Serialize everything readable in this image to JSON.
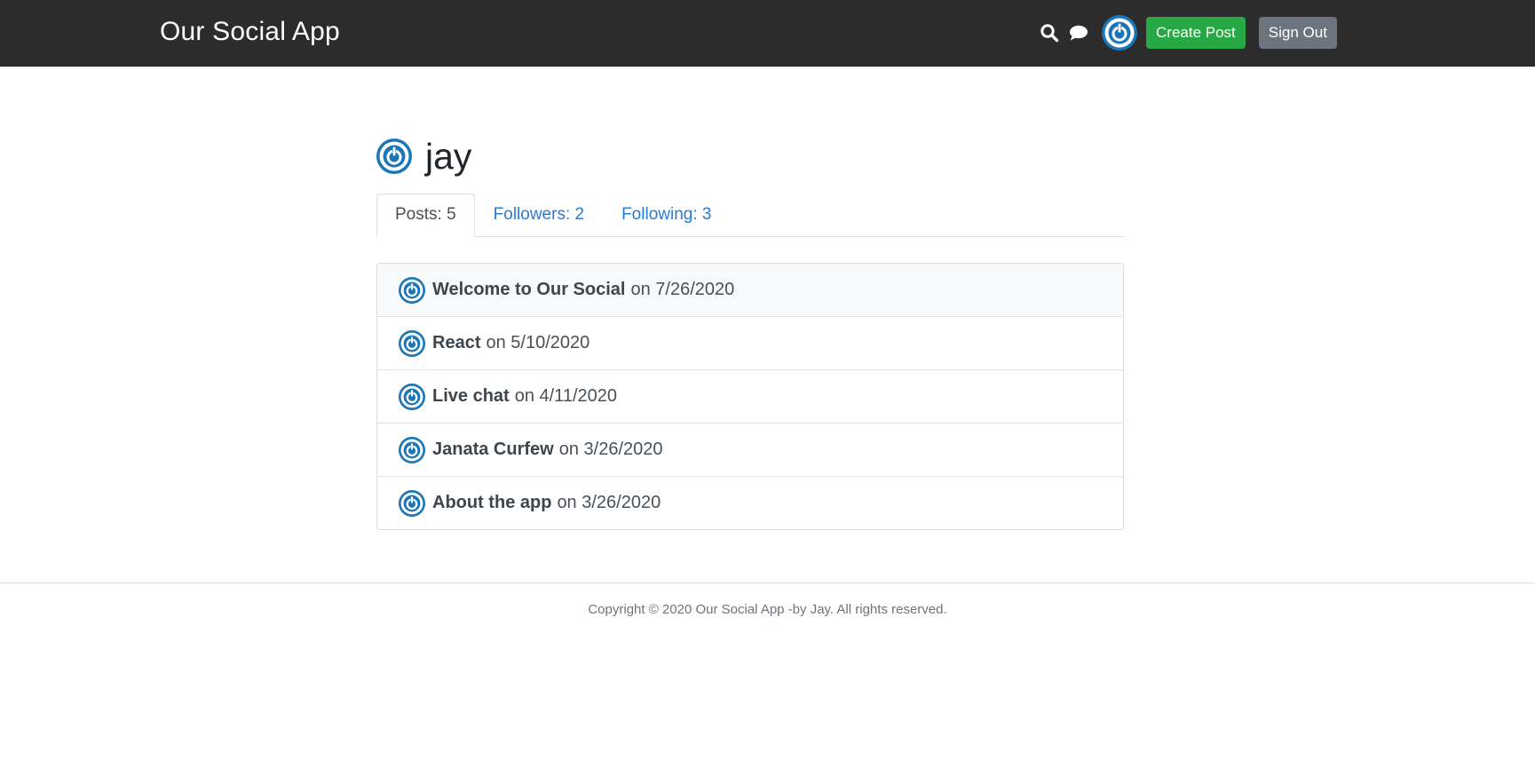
{
  "header": {
    "brand": "Our Social App",
    "icons": {
      "search": "search-icon",
      "chat": "chat-icon",
      "avatar": "avatar"
    },
    "create_post_label": "Create Post",
    "sign_out_label": "Sign Out"
  },
  "profile": {
    "username": "jay"
  },
  "tabs": [
    {
      "label": "Posts: 5",
      "active": true
    },
    {
      "label": "Followers: 2",
      "active": false
    },
    {
      "label": "Following: 3",
      "active": false
    }
  ],
  "posts": [
    {
      "title": "Welcome to Our Social",
      "date": "on 7/26/2020"
    },
    {
      "title": "React",
      "date": "on 5/10/2020"
    },
    {
      "title": "Live chat",
      "date": "on 4/11/2020"
    },
    {
      "title": "Janata Curfew",
      "date": "on 3/26/2020"
    },
    {
      "title": "About the app",
      "date": "on 3/26/2020"
    }
  ],
  "footer": {
    "copyright": "Copyright © 2020 Our Social App -by Jay. All rights reserved."
  },
  "colors": {
    "header_bg": "#2c2c2c",
    "avatar_blue": "#1a76b8",
    "create_button": "#28a745",
    "sign_out_button": "#6c757d",
    "tab_link": "#2a7ad4"
  }
}
